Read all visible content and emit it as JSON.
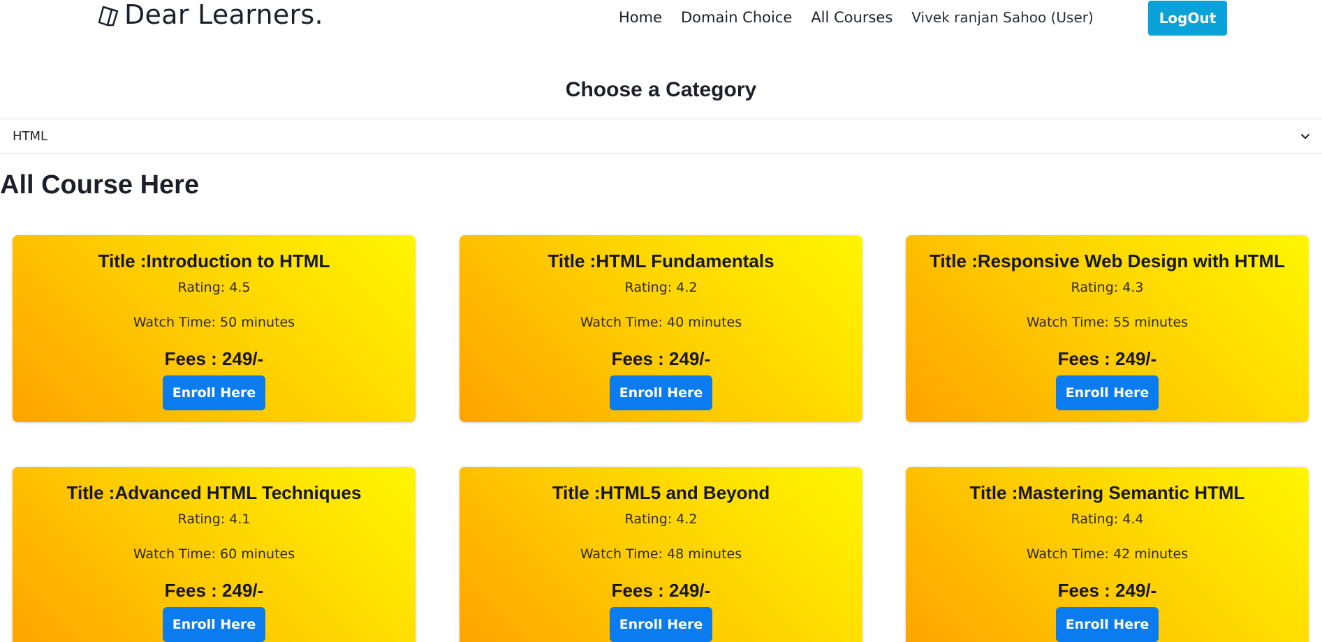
{
  "brand": {
    "name": "Dear Learners.",
    "icon": "book-icon"
  },
  "nav": {
    "items": [
      {
        "label": "Home"
      },
      {
        "label": "Domain Choice"
      },
      {
        "label": "All Courses"
      }
    ],
    "user": "Vivek ranjan Sahoo (User)",
    "logout_label": "LogOut"
  },
  "category": {
    "heading": "Choose a Category",
    "selected": "HTML"
  },
  "courses": {
    "heading": "All Course Here",
    "items": [
      {
        "title": "Title :Introduction to HTML",
        "rating": "Rating: 4.5",
        "watch": "Watch Time: 50 minutes",
        "fees": "Fees : 249/-",
        "button": "Enroll Here"
      },
      {
        "title": "Title :HTML Fundamentals",
        "rating": "Rating: 4.2",
        "watch": "Watch Time: 40 minutes",
        "fees": "Fees : 249/-",
        "button": "Enroll Here"
      },
      {
        "title": "Title :Responsive Web Design with HTML",
        "rating": "Rating: 4.3",
        "watch": "Watch Time: 55 minutes",
        "fees": "Fees : 249/-",
        "button": "Enroll Here"
      },
      {
        "title": "Title :Advanced HTML Techniques",
        "rating": "Rating: 4.1",
        "watch": "Watch Time: 60 minutes",
        "fees": "Fees : 249/-",
        "button": "Enroll Here"
      },
      {
        "title": "Title :HTML5 and Beyond",
        "rating": "Rating: 4.2",
        "watch": "Watch Time: 48 minutes",
        "fees": "Fees : 249/-",
        "button": "Enroll Here"
      },
      {
        "title": "Title :Mastering Semantic HTML",
        "rating": "Rating: 4.4",
        "watch": "Watch Time: 42 minutes",
        "fees": "Fees : 249/-",
        "button": "Enroll Here"
      }
    ]
  },
  "colors": {
    "logout_bg": "#0aa2d8",
    "enroll_bg": "#0a7cf0",
    "card_gradient_start": "#ffa200",
    "card_gradient_end": "#fff700"
  }
}
